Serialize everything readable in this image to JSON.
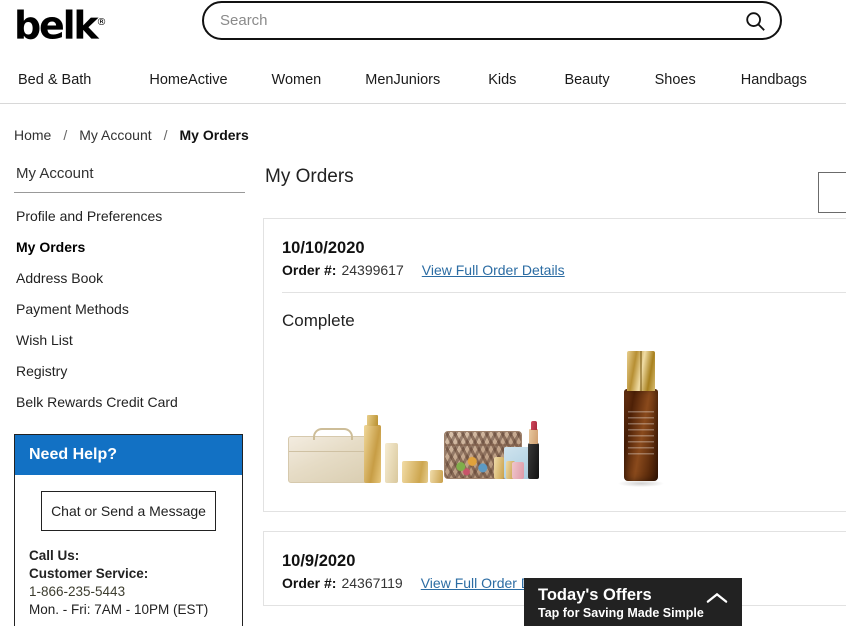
{
  "header": {
    "logo_text": "belk",
    "logo_tm": "®",
    "search": {
      "placeholder": "Search",
      "value": "",
      "icon": "search-icon"
    }
  },
  "nav": {
    "items": [
      {
        "label": "Bed & Bath"
      },
      {
        "label": "Home"
      },
      {
        "label": "Active"
      },
      {
        "label": "Women"
      },
      {
        "label": "Men"
      },
      {
        "label": "Juniors"
      },
      {
        "label": "Kids"
      },
      {
        "label": "Beauty"
      },
      {
        "label": "Shoes"
      },
      {
        "label": "Handbags"
      }
    ]
  },
  "breadcrumb": {
    "items": [
      {
        "label": "Home",
        "active": false
      },
      {
        "label": "My Account",
        "active": false
      },
      {
        "label": "My Orders",
        "active": true
      }
    ],
    "separator": "/"
  },
  "sidebar": {
    "title": "My Account",
    "items": [
      {
        "label": "Profile and Preferences",
        "current": false
      },
      {
        "label": "My Orders",
        "current": true
      },
      {
        "label": "Address Book",
        "current": false
      },
      {
        "label": "Payment Methods",
        "current": false
      },
      {
        "label": "Wish List",
        "current": false
      },
      {
        "label": "Registry",
        "current": false
      },
      {
        "label": "Belk Rewards Credit Card",
        "current": false
      }
    ],
    "help": {
      "heading": "Need Help?",
      "chat_button": "Chat or Send a Message",
      "call_label": "Call Us:",
      "service_label": "Customer Service:",
      "phone": "1-866-235-5443",
      "hours": "Mon. - Fri: 7AM - 10PM (EST)",
      "accent_color": "#1271c4"
    }
  },
  "main": {
    "page_title": "My Orders",
    "orders": [
      {
        "date": "10/10/2020",
        "order_label": "Order #:",
        "order_number": "24399617",
        "details_link": "View Full Order Details",
        "status": "Complete",
        "items": [
          {
            "name": "gold-cosmetic-gift-set"
          },
          {
            "name": "snakeskin-pouch-beauty-set"
          },
          {
            "name": "advanced-night-repair-serum"
          }
        ]
      },
      {
        "date": "10/9/2020",
        "order_label": "Order #:",
        "order_number": "24367119",
        "details_link": "View Full Order Details",
        "status": "",
        "items": []
      }
    ]
  },
  "offers": {
    "title": "Today's Offers",
    "subtitle": "Tap for Saving Made Simple",
    "icon": "chevron-up-icon",
    "background_color": "#222222"
  }
}
